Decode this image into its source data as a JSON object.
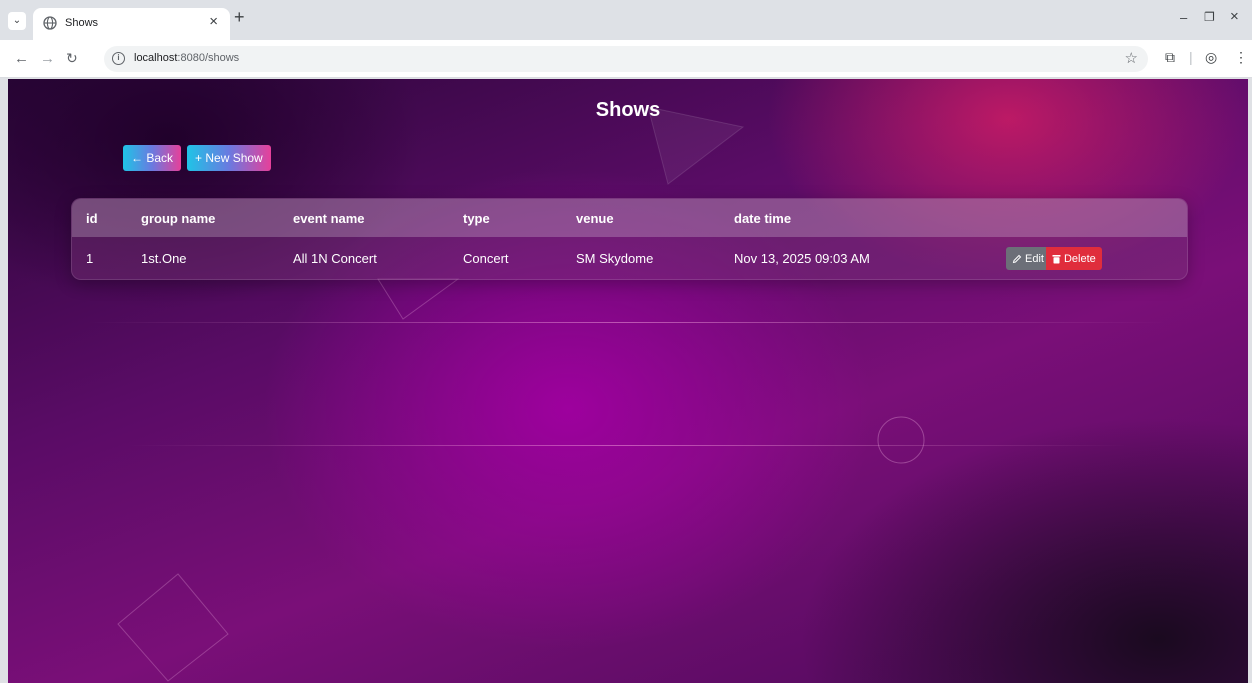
{
  "browser": {
    "tab_title": "Shows",
    "url_host": "localhost",
    "url_path": ":8080/shows"
  },
  "page": {
    "title": "Shows",
    "back_label": "← Back",
    "new_show_label": "+ New Show"
  },
  "table": {
    "headers": {
      "id": "id",
      "group_name": "group name",
      "event_name": "event name",
      "type": "type",
      "venue": "venue",
      "date_time": "date time"
    },
    "rows": [
      {
        "id": "1",
        "group_name": "1st.One",
        "event_name": "All 1N Concert",
        "type": "Concert",
        "venue": "SM Skydome",
        "date_time": "Nov 13, 2025 09:03 AM",
        "edit_label": "Edit",
        "delete_label": "Delete"
      }
    ]
  },
  "colors": {
    "delete": "#e02d3c",
    "edit": "#6c6f78",
    "button_gradient_start": "#1fc4e6",
    "button_gradient_end": "#e6409a"
  }
}
